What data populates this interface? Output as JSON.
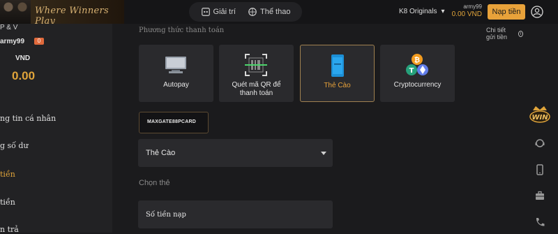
{
  "header": {
    "slogan": "Where Winners Play",
    "nav": [
      {
        "label": "Giải trí",
        "icon": "gamepad-icon"
      },
      {
        "label": "Thể thao",
        "icon": "ball-icon"
      }
    ],
    "k8_label": "K8 Originals",
    "username": "army99",
    "balance": "0.00 VND",
    "deposit_button": "Nạp tiền"
  },
  "sidebar": {
    "vip": "P & V",
    "username": "army99",
    "badge": "0",
    "currency": "VND",
    "balance": "0.00",
    "menu": [
      {
        "label": "ng tin cá nhân",
        "active": false
      },
      {
        "label": "g số dư",
        "active": false
      },
      {
        "label": "tiền",
        "active": true
      },
      {
        "label": "tiền",
        "active": false
      },
      {
        "label": "n trả",
        "active": false
      }
    ]
  },
  "main": {
    "section_title": "Phương thức thanh toán",
    "detail_link": "Chi tiết gửi tiền",
    "methods": [
      {
        "label": "Autopay",
        "icon": "monitor-icon",
        "selected": false
      },
      {
        "label": "Quét mã QR để thanh toán",
        "icon": "qr-scan-icon",
        "selected": false
      },
      {
        "label": "Thẻ Cào",
        "icon": "card-icon",
        "selected": true
      },
      {
        "label": "Cryptocurrency",
        "icon": "crypto-coins-icon",
        "selected": false
      }
    ],
    "provider_logo": "MAXGATE88PCARD",
    "provider_sub": "",
    "select_value": "Thẻ Cào",
    "choose_label": "Chọn thẻ",
    "amount_placeholder": "Số tiền nạp"
  },
  "rightbar": {
    "win_text": "WIN",
    "icons": [
      "support-icon",
      "mobile-icon",
      "briefcase-icon",
      "phone-icon"
    ]
  },
  "colors": {
    "accent": "#e8a23a",
    "background": "#1b1b1d",
    "panel": "#2a2a2d"
  }
}
